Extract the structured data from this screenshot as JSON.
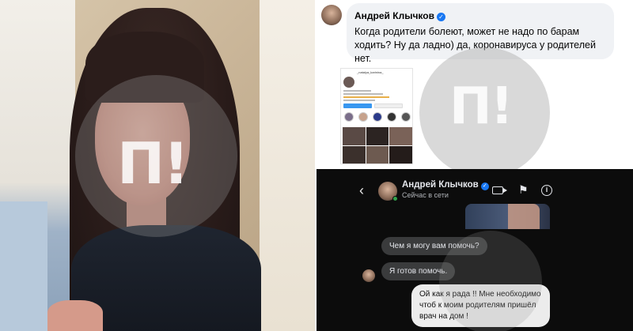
{
  "photo": {
    "watermark": "П!"
  },
  "facebook_comment": {
    "author": "Андрей Клычков",
    "verified_mark": "✓",
    "text": "Когда родители болеют, может не надо по барам ходить? Ну да ладно) да, коронавируса у родителей нет.",
    "watermark": "П!",
    "attachment": {
      "handle": "_natalya_karinina_"
    }
  },
  "messenger": {
    "back_icon": "‹",
    "contact_name": "Андрей Клычков",
    "verified_mark": "✓",
    "status": "Сейчас в сети",
    "info_icon": "i",
    "flag_icon": "⚑",
    "messages": [
      {
        "from": "contact",
        "text": "Чем я могу вам помочь?"
      },
      {
        "from": "contact",
        "text": "Я готов помочь."
      },
      {
        "from": "user",
        "text": "Ой как я рада !! Мне необходимо чтоб к моим родителям пришёл врач на дом !"
      }
    ],
    "colors": {
      "background": "#0c0c0c",
      "incoming_bubble": "#3a3b3c",
      "outgoing_bubble": "#ececec",
      "online": "#31a24c",
      "verified": "#1877f2"
    }
  }
}
